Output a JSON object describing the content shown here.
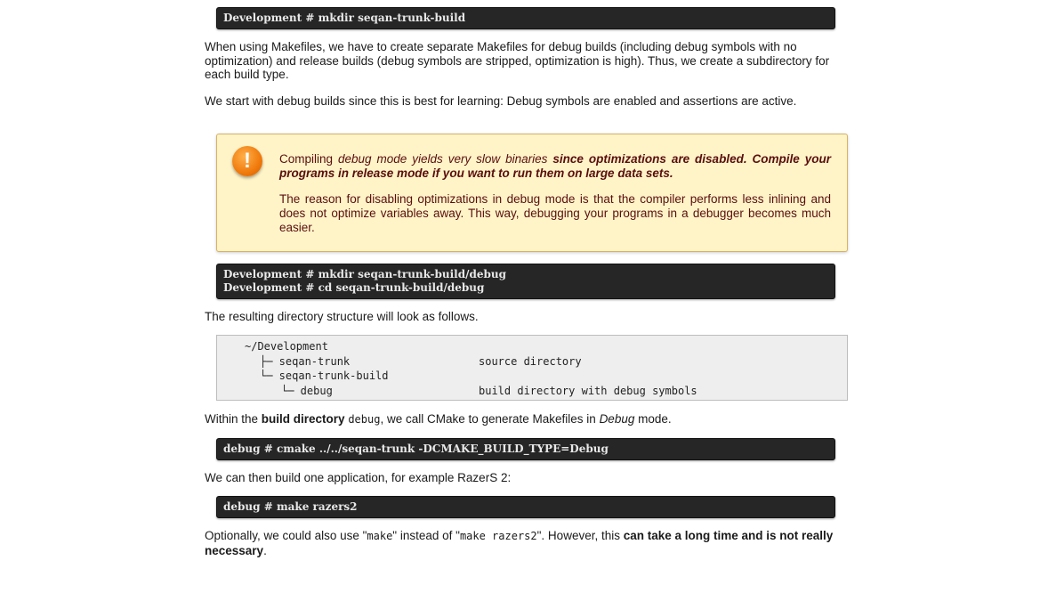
{
  "cmd1": "Development # mkdir seqan-trunk-build",
  "para1": "When using Makefiles, we have to create separate Makefiles for debug builds (including debug symbols with no optimization) and release builds (debug symbols are stripped, optimization is high). Thus, we create a subdirectory for each build type.",
  "para2": "We start with debug builds since this is best for learning: Debug symbols are enabled and assertions are active.",
  "warning": {
    "icon": "!",
    "line1_a": "Compiling ",
    "line1_b": "debug mode yields very slow binaries",
    "line1_c": " since optimizations are disabled. Compile your programs in release mode if you want to run them on large data sets.",
    "line2": "The reason for disabling optimizations in debug mode is that the compiler performs less inlining and does not optimize variables away. This way, debugging your programs in a debugger becomes much easier."
  },
  "cmd2": "Development # mkdir seqan-trunk-build/debug\nDevelopment # cd seqan-trunk-build/debug",
  "para3": "The resulting directory structure will look as follows.",
  "tree": {
    "root": "~/Development",
    "rows": [
      {
        "name": "├─ seqan-trunk",
        "desc": "source directory"
      },
      {
        "name": "└─ seqan-trunk-build",
        "desc": ""
      },
      {
        "name": "└─ debug",
        "desc": "build directory with debug symbols"
      }
    ]
  },
  "para4": {
    "a": "Within the ",
    "b": "build directory",
    "c": " ",
    "d": "debug",
    "e": ", we call CMake to generate Makefiles in ",
    "f": "Debug",
    "g": " mode."
  },
  "cmd3": "debug # cmake ../../seqan-trunk -DCMAKE_BUILD_TYPE=Debug",
  "para5": "We can then build one application, for example RazerS 2:",
  "cmd4": "debug # make razers2",
  "para6": {
    "a": "Optionally, we could also use \"",
    "b": "make",
    "c": "\" instead of \"",
    "d": "make razers2",
    "e": "\". However, this ",
    "f": "can take a long time and is not really necessary",
    "g": "."
  }
}
